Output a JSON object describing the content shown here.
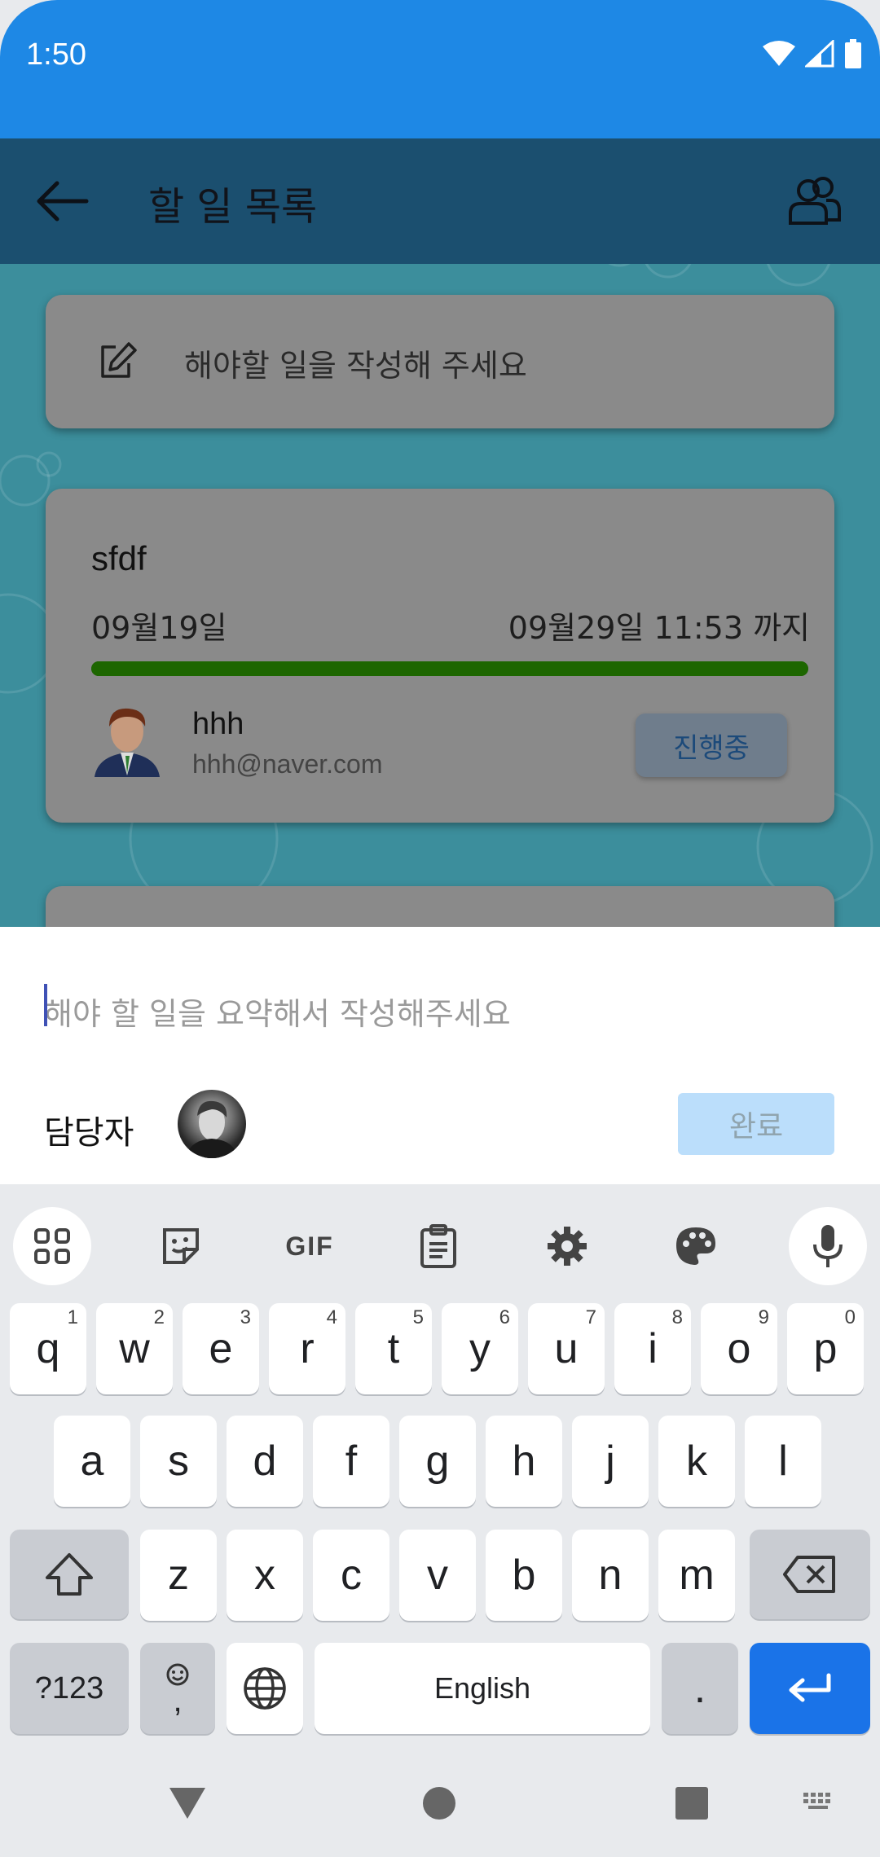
{
  "status_bar": {
    "time": "1:50",
    "color": "#1e88e5"
  },
  "app_bar": {
    "title": "할 일 목록",
    "back_icon": "arrow-left-icon",
    "people_icon": "people-icon"
  },
  "task_input": {
    "placeholder_label": "해야할 일을 작성해 주세요",
    "icon": "edit-icon"
  },
  "task": {
    "title": "sfdf",
    "start_date": "09월19일",
    "due_text": "09월29일 11:53 까지",
    "progress": 1.0,
    "assignee_name": "hhh",
    "assignee_email": "hhh@naver.com",
    "status_label": "진행중"
  },
  "sheet": {
    "summary_placeholder": "해야 할 일을 요약해서 작성해주세요",
    "assignee_label": "담당자",
    "done_label": "완료"
  },
  "keyboard": {
    "row1": [
      {
        "k": "q",
        "n": "1"
      },
      {
        "k": "w",
        "n": "2"
      },
      {
        "k": "e",
        "n": "3"
      },
      {
        "k": "r",
        "n": "4"
      },
      {
        "k": "t",
        "n": "5"
      },
      {
        "k": "y",
        "n": "6"
      },
      {
        "k": "u",
        "n": "7"
      },
      {
        "k": "i",
        "n": "8"
      },
      {
        "k": "o",
        "n": "9"
      },
      {
        "k": "p",
        "n": "0"
      }
    ],
    "row2": [
      "a",
      "s",
      "d",
      "f",
      "g",
      "h",
      "j",
      "k",
      "l"
    ],
    "row3": [
      "z",
      "x",
      "c",
      "v",
      "b",
      "n",
      "m"
    ],
    "symbols_label": "?123",
    "emoji_comma": ",",
    "space_label": "English",
    "period_label": ".",
    "gif_label": "GIF",
    "enter_color": "#1a73e8"
  }
}
